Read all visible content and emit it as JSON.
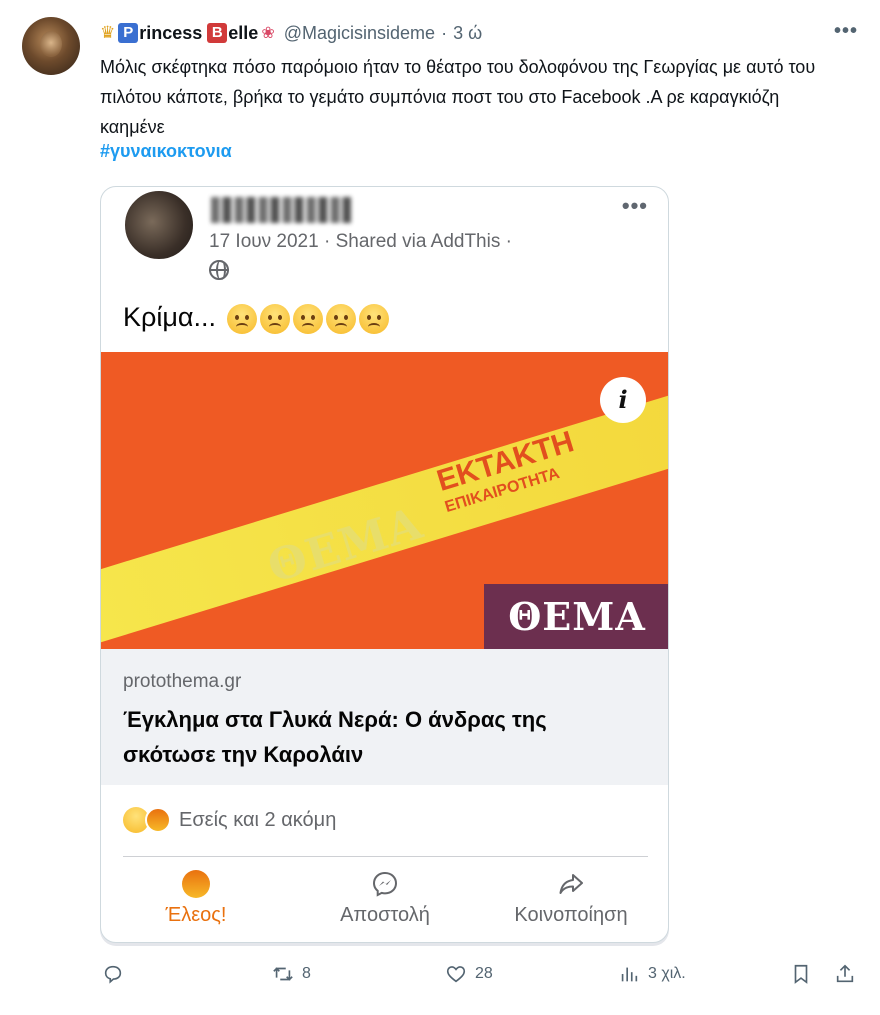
{
  "tweet": {
    "display_name_part1": "rincess",
    "display_name_part2": "elle",
    "badge_letter_1": "P",
    "badge_letter_2": "B",
    "handle": "@Magicisinsideme",
    "separator": "·",
    "time": "3 ώ",
    "text": "Μόλις σκέφτηκα  πόσο παρόμοιο ήταν το θέατρο του δολοφόνου της Γεωργίας με αυτό του πιλότου κάποτε, βρήκα το γεμάτο συμπόνια ποστ του στο Facebook .Α ρε καραγκιόζη καημένε",
    "hashtag": "#γυναικοκτονια"
  },
  "embedded_post": {
    "meta": "17 Ιουν 2021 · Shared via AddThis ·",
    "post_text": "Κρίμα...",
    "sad_emoji_count": 5,
    "banner": {
      "stripe_brand": "ΘΕΜΑ",
      "stripe_title": "ΕΚΤΑΚΤΗ",
      "stripe_subtitle": "ΕΠΙΚΑΙΡΟΤΗΤΑ",
      "info_glyph": "i",
      "brand_box": "ΘΕΜΑ",
      "colors": {
        "background": "#ef5a24",
        "stripe": "#f6e84e",
        "brand_box": "#6c2f4f"
      }
    },
    "link": {
      "domain": "protothema.gr",
      "title": "Έγκλημα στα Γλυκά Νερά: Ο άνδρας της σκότωσε την Καρολάιν"
    },
    "reactions_text": "Εσείς και 2 ακόμη",
    "actions": {
      "like": "Έλεος!",
      "send": "Αποστολή",
      "share": "Κοινοποίηση"
    }
  },
  "tweet_actions": {
    "reply_icon": "reply-icon",
    "retweet_count": "8",
    "like_count": "28",
    "views_count": "3 χιλ."
  },
  "colors": {
    "link_blue": "#1d9bf0",
    "secondary_text": "#536471"
  }
}
